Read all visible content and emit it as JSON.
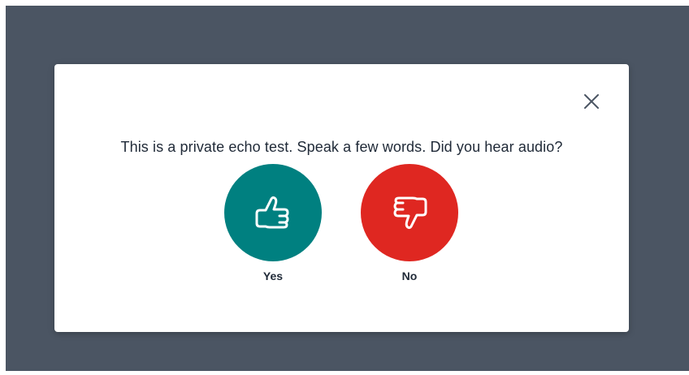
{
  "dialog": {
    "question": "This is a private echo test. Speak a few words. Did you hear audio?",
    "close_icon": "close-icon",
    "answers": [
      {
        "label": "Yes",
        "icon": "thumbs-up-icon",
        "color": "#008080"
      },
      {
        "label": "No",
        "icon": "thumbs-down-icon",
        "color": "#df2721"
      }
    ]
  },
  "colors": {
    "backdrop": "#4b5563",
    "modal": "#ffffff",
    "text": "#1f2937"
  }
}
